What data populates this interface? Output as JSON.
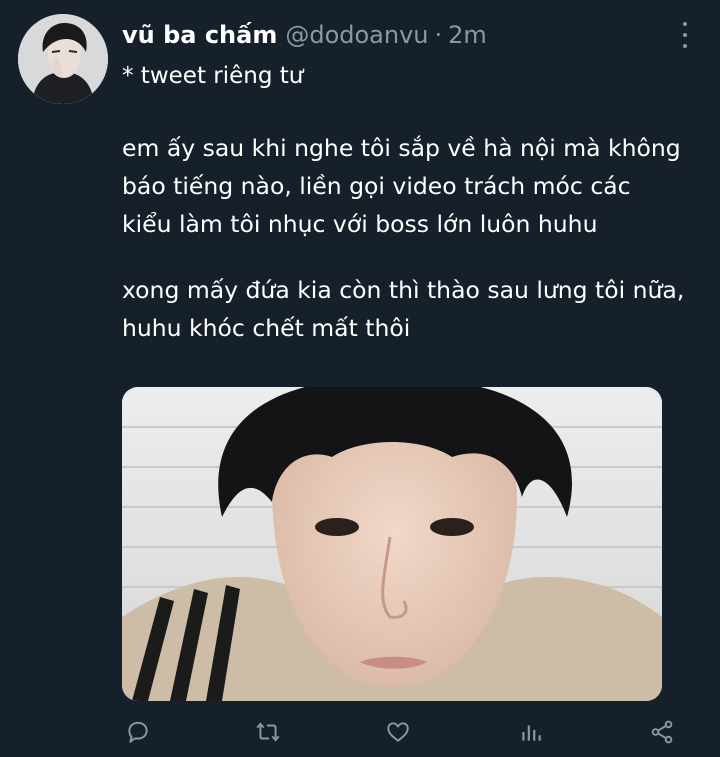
{
  "tweet": {
    "display_name": "vũ ba chấm",
    "handle": "@dodoanvu",
    "separator": "·",
    "timestamp": "2m",
    "subtitle": "* tweet riêng tư",
    "paragraphs": [
      [
        "em ấy sau khi nghe tôi sắp về hà nội mà không",
        "báo tiếng nào, liền gọi video trách móc các",
        "kiểu làm tôi nhục với boss lớn luôn huhu"
      ],
      [
        "xong mấy đứa kia còn thì thào sau lưng tôi nữa,",
        "huhu khóc chết mất thôi"
      ]
    ],
    "media": {
      "type": "photo",
      "subject": "close-up of young man looking at camera"
    }
  },
  "actions": {
    "reply": "reply-icon",
    "retweet": "retweet-icon",
    "like": "heart-icon",
    "analytics": "analytics-icon",
    "share": "share-icon"
  },
  "colors": {
    "background": "#15202b",
    "text": "#ffffff",
    "secondary": "#8899a6"
  }
}
